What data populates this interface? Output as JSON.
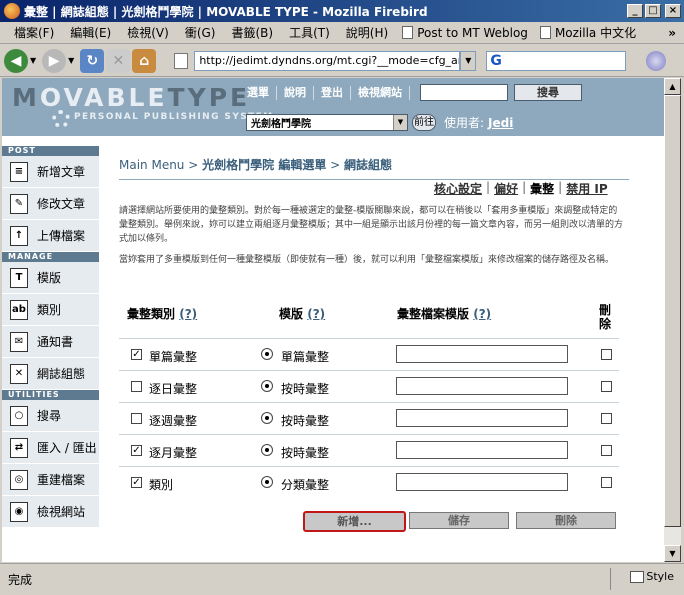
{
  "window": {
    "title": "彙整 | 網誌組態 | 光劍格鬥學院 | MOVABLE TYPE - Mozilla Firebird",
    "controls": [
      "_",
      "□",
      "×"
    ]
  },
  "menu": {
    "items": [
      "檔案(F)",
      "編輯(E)",
      "檢視(V)",
      "衝(G)",
      "書籤(B)",
      "工具(T)",
      "說明(H)"
    ],
    "bookmarks": [
      "Post to MT Weblog",
      "Mozilla 中文化"
    ],
    "more": "»"
  },
  "nav": {
    "url": "http://jedimt.dyndns.org/mt.cgi?__mode=cfg_archives&",
    "search_engine_letter": "G"
  },
  "mt": {
    "logo_dark": "M",
    "logo_light": "VABLE",
    "logo_dark2": "TYPE",
    "logo_sub": "PERSONAL PUBLISHING SYSTEM",
    "nav_links": [
      "選單",
      "說明",
      "登出",
      "檢視網站"
    ],
    "search_button": "搜尋",
    "blog_select": "光劍格鬥學院",
    "go_button": "前往",
    "user_label": "使用者:",
    "user_name": "Jedi"
  },
  "sidebar": {
    "sections": [
      {
        "title": "POST",
        "items": [
          {
            "label": "新增文章",
            "icon": "doc-icon"
          },
          {
            "label": "修改文章",
            "icon": "edit-icon"
          },
          {
            "label": "上傳檔案",
            "icon": "upload-icon"
          }
        ]
      },
      {
        "title": "MANAGE",
        "items": [
          {
            "label": "模版",
            "icon": "template-icon"
          },
          {
            "label": "類別",
            "icon": "category-icon"
          },
          {
            "label": "通知書",
            "icon": "mail-icon"
          },
          {
            "label": "網誌組態",
            "icon": "tools-icon"
          }
        ]
      },
      {
        "title": "UTILITIES",
        "items": [
          {
            "label": "搜尋",
            "icon": "search-icon"
          },
          {
            "label": "匯入 / 匯出",
            "icon": "import-export-icon"
          },
          {
            "label": "重建檔案",
            "icon": "rebuild-icon"
          },
          {
            "label": "檢視網站",
            "icon": "view-site-icon"
          }
        ]
      }
    ]
  },
  "main": {
    "breadcrumb": {
      "root": "Main Menu",
      "sep": ">",
      "blog": "光劍格鬥學院 編輯選單",
      "current": "網誌組態"
    },
    "subtabs": [
      "核心設定",
      "偏好",
      "彙整",
      "禁用 IP"
    ],
    "help_text_1": "請選擇網站所要使用的彙整類別。對於每一種被選定的彙整-模版關聯來說，都可以在稍後以「套用多重模版」來調整成特定的彙整類別。舉例來說，妳可以建立兩組逐月彙整模版；其中一組是顯示出該月份裡的每一篇文章內容，而另一組則改以清單的方式加以條列。",
    "help_text_2": "當妳套用了多重模版到任何一種彙整模版（即使就有一種）後，就可以利用「彙整檔案模版」來修改檔案的儲存路徑及名稱。",
    "table": {
      "headers": {
        "archive_type": "彙整類別",
        "template": "模版",
        "archive_file_template": "彙整檔案模版",
        "delete": "刪除"
      },
      "help_mark": "(?)",
      "rows": [
        {
          "type": "單篇彙整",
          "checked": true,
          "template": "單篇彙整",
          "file": ""
        },
        {
          "type": "逐日彙整",
          "checked": false,
          "template": "按時彙整",
          "file": ""
        },
        {
          "type": "逐週彙整",
          "checked": false,
          "template": "按時彙整",
          "file": ""
        },
        {
          "type": "逐月彙整",
          "checked": true,
          "template": "按時彙整",
          "file": ""
        },
        {
          "type": "類別",
          "checked": true,
          "template": "分類彙整",
          "file": ""
        }
      ]
    },
    "buttons": {
      "add": "新增...",
      "save": "儲存",
      "delete": "刪除"
    }
  },
  "status": {
    "text": "完成",
    "style_label": "Style"
  },
  "colors": {
    "mt_header": "#8ea9bd",
    "sidebar_head": "#5e7a90",
    "link": "#3a5f7c",
    "highlight": "#c01818"
  }
}
